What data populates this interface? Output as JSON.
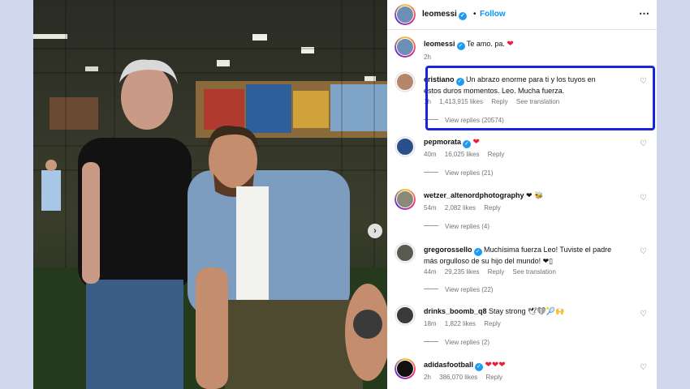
{
  "header": {
    "username": "leomessi",
    "separator": "•",
    "follow_label": "Follow",
    "more_icon": "⋯"
  },
  "photo": {
    "next_glyph": "›"
  },
  "caption": {
    "username": "leomessi",
    "text": "Te amo. pa.",
    "emoji": "❤",
    "time": "2h"
  },
  "comments": [
    {
      "username": "cristiano",
      "verified": true,
      "text": "Un abrazo enorme para ti y los tuyos en estos duros momentos. Leo. Mucha fuerza.",
      "time": "1h",
      "likes": "1,413,915 likes",
      "reply_label": "Reply",
      "translate_label": "See translation",
      "replies": "View replies (20574)",
      "highlighted": true
    },
    {
      "username": "pepmorata",
      "verified": true,
      "text": "❤",
      "time": "40m",
      "likes": "16,025 likes",
      "reply_label": "Reply",
      "replies": "View replies (21)"
    },
    {
      "username": "wetzer_altenordphotography",
      "verified": false,
      "text": "❤ 🐝",
      "time": "54m",
      "likes": "2,082 likes",
      "reply_label": "Reply",
      "replies": "View replies (4)"
    },
    {
      "username": "gregorossello",
      "verified": true,
      "text": "Muchísima fuerza Leo! Tuviste el padre más orgulloso de su hijo del mundo! ❤▯",
      "time": "44m",
      "likes": "29,235 likes",
      "reply_label": "Reply",
      "translate_label": "See translation",
      "replies": "View replies (22)"
    },
    {
      "username": "drinks_boomb_q8",
      "verified": false,
      "text": "Stay strong 🕊❤🎾🙌",
      "time": "18m",
      "likes": "1,822 likes",
      "reply_label": "Reply",
      "replies": "View replies (2)"
    },
    {
      "username": "adidasfootball",
      "verified": true,
      "text": "❤❤❤",
      "time": "2h",
      "likes": "386,070 likes",
      "reply_label": "Reply"
    }
  ],
  "icons": {
    "heart": "♡",
    "verified": "✓"
  },
  "colors": {
    "accent": "#0095f6",
    "highlight_border": "#1a24e0",
    "verified": "#1d9bf0",
    "heart_red": "#ed1c3a"
  }
}
